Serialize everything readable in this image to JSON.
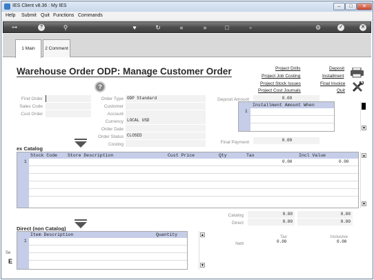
{
  "window": {
    "title": "IES Client v8.36 : My IES"
  },
  "menu": [
    "Help",
    "Submit",
    "Quit",
    "Functions",
    "Commands"
  ],
  "tabs": [
    {
      "label": "1 Main",
      "active": true
    },
    {
      "label": "2 Comment",
      "active": false
    }
  ],
  "page": {
    "title": "Warehouse Order ODP: Manage Customer Order"
  },
  "links_col1": [
    "Project Drills",
    "Project Job Costing",
    "Project Stock Issues",
    "Project Cost Journals"
  ],
  "links_col2": [
    "Deposit",
    "Installment",
    "Final Invoice",
    "Quit"
  ],
  "left_form": {
    "find_order_label": "Find Order",
    "sales_code_label": "Sales Code",
    "cust_order_label": "Cust Order"
  },
  "mid_form": {
    "order_type_label": "Order Type",
    "order_type": "ODP Standard",
    "customer_label": "Customer",
    "customer": "",
    "account_label": "Account",
    "account": "",
    "currency_label": "Currency",
    "currency": "LOCAL USD",
    "order_date_label": "Order Date",
    "order_date": "",
    "order_status_label": "Order Status",
    "order_status": "CLOSED",
    "costing_label": "Costing",
    "costing": ""
  },
  "deposit": {
    "deposit_amount_label": "Deposit Amount",
    "deposit_amount": "0.00",
    "installment_header": "Installment Amount When",
    "installment_row": "1",
    "final_payment_label": "Final Payment",
    "final_payment": "0.00"
  },
  "catalog": {
    "section_label": "ex Catalog",
    "columns": [
      "Stock Code",
      "Store Description",
      "Cust Price",
      "Qty",
      "Tax",
      "Incl Value"
    ],
    "rows": [
      {
        "num": "1",
        "tax": "0.00",
        "incl_value": "0.00"
      }
    ]
  },
  "totals": {
    "catalog_label": "Catalog",
    "catalog_tax": "0.00",
    "catalog_incl": "0.00",
    "direct_label": "Direct",
    "direct_tax": "0.00",
    "direct_incl": "0.00",
    "tax_header": "Tax",
    "inclusive_header": "Inclusive",
    "nett_label": "Nett",
    "nett_tax": "0.00",
    "nett_incl": "0.00"
  },
  "direct": {
    "section_label": "Direct (non Catalog)",
    "columns": [
      "Item Description",
      "Quantity"
    ],
    "rows": [
      {
        "num": "1"
      }
    ]
  },
  "left_edge": {
    "text1": "Se",
    "text2": "E"
  },
  "colors": {
    "grid_header": "#c5cde8",
    "toolbar": "#4e4e4e",
    "titlebar": "#c9d8ea"
  }
}
